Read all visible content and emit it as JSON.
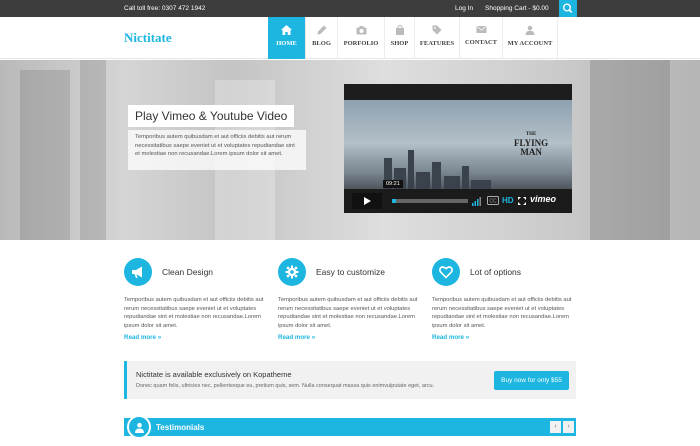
{
  "topbar": {
    "phone": "Call toll free: 0307 472 1942",
    "login": "Log In",
    "cart": "Shopping Cart - $0.00"
  },
  "header": {
    "logo": "Nictitate",
    "nav": [
      {
        "label": "HOME",
        "icon": "home-icon",
        "active": true
      },
      {
        "label": "BLOG",
        "icon": "pencil-icon",
        "active": false
      },
      {
        "label": "PORFOLIO",
        "icon": "camera-icon",
        "active": false
      },
      {
        "label": "SHOP",
        "icon": "bag-icon",
        "active": false
      },
      {
        "label": "FEATURES",
        "icon": "tag-icon",
        "active": false
      },
      {
        "label": "CONTACT",
        "icon": "envelope-icon",
        "active": false
      },
      {
        "label": "MY ACCOUNT",
        "icon": "user-icon",
        "active": false
      }
    ]
  },
  "hero": {
    "title": "Play Vimeo & Youtube Video",
    "text": "Temporibus autem quibusdam et aut officiis debitis aut rerum necessitatibus saepe eveniet ut et voluptates repudiandae sint et molestiae non recusandae.Lorem ipsum dolor sit amet.",
    "video": {
      "film_title_1": "THE",
      "film_title_2": "FLYING",
      "film_title_3": "MAN",
      "time": "09:21",
      "hd": "HD",
      "brand": "vimeo"
    }
  },
  "features": [
    {
      "title": "Clean Design",
      "icon": "megaphone-icon",
      "text": "Temporibus autem quibusdam et aut officiis debitis aut rerum necessitatibus saepe eveniet ut et voluptates repudiandae sint et molestiae non recusandae.Lorem ipsum dolor sit amet.",
      "more": "Read more »"
    },
    {
      "title": "Easy to customize",
      "icon": "gear-icon",
      "text": "Temporibus autem quibusdam et aut officiis debitis aut rerum necessitatibus saepe eveniet ut et voluptates repudiandae sint et molestiae non recusandae.Lorem ipsum dolor sit amet.",
      "more": "Read more »"
    },
    {
      "title": "Lot of options",
      "icon": "heart-icon",
      "text": "Temporibus autem quibusdam et aut officiis debitis aut rerum necessitatibus saepe eveniet ut et voluptates repudiandae sint et molestiae non recusandae.Lorem ipsum dolor sit amet.",
      "more": "Read more »"
    }
  ],
  "promo": {
    "title": "Nictitate is available exclusively on Kopatheme",
    "text": "Donec quam felis, ultricies nec, pellentesque eu, pretium quis, sem. Nulla consequat massa quis enimvulputate eget, arcu.",
    "button": "Buy now for only $55"
  },
  "testimonials": {
    "label": "Testimonials",
    "prev": "‹",
    "next": "›"
  },
  "colors": {
    "accent": "#1cb6e0",
    "topbar": "#3d3d3d"
  }
}
